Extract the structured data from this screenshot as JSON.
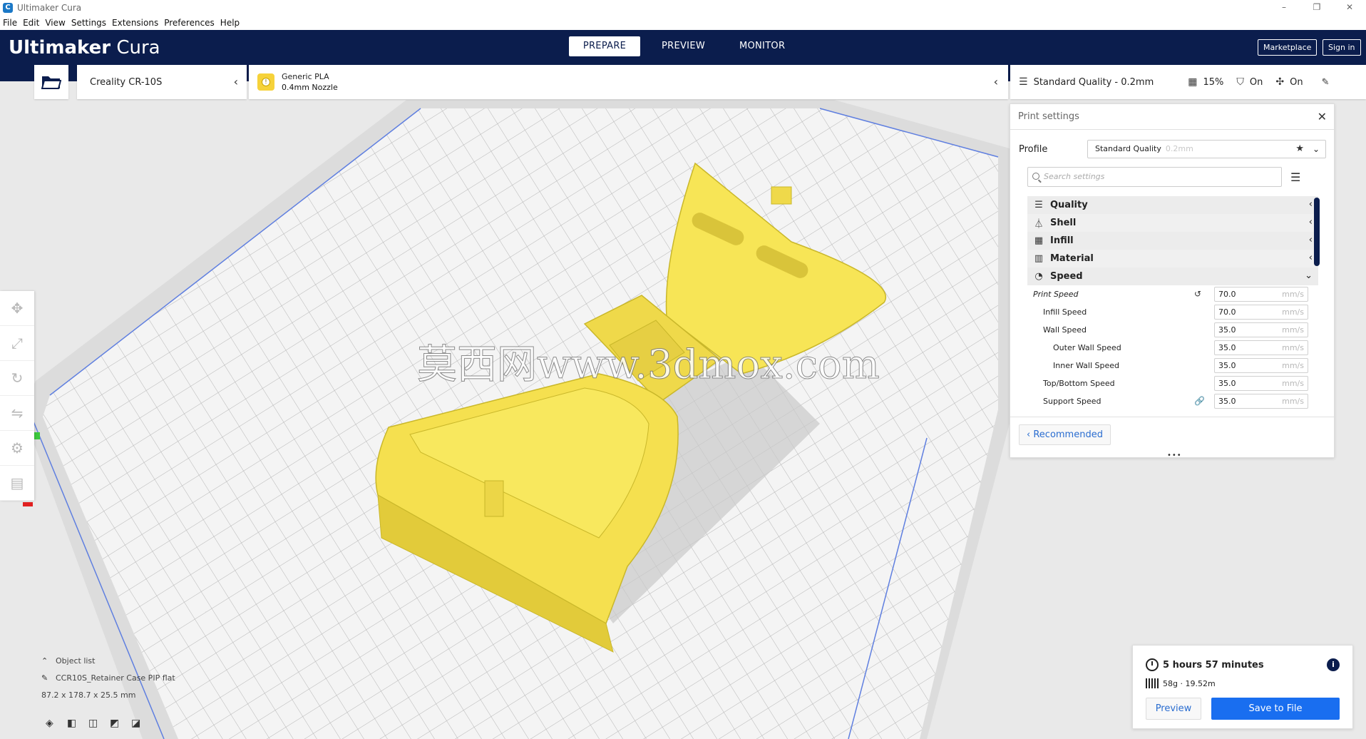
{
  "window": {
    "title": "Ultimaker Cura",
    "controls": [
      "–",
      "❐",
      "✕"
    ]
  },
  "menu": [
    "File",
    "Edit",
    "View",
    "Settings",
    "Extensions",
    "Preferences",
    "Help"
  ],
  "header": {
    "logo_bold": "Ultimaker",
    "logo_light": "Cura",
    "tabs": [
      "PREPARE",
      "PREVIEW",
      "MONITOR"
    ],
    "active_tab": "PREPARE",
    "marketplace": "Marketplace",
    "sign_in": "Sign in"
  },
  "stage": {
    "printer": "Creality CR-10S",
    "material": "Generic PLA",
    "nozzle": "0.4mm Nozzle",
    "quality": "Standard Quality - 0.2mm",
    "infill": "15%",
    "support": "On",
    "adhesion": "On"
  },
  "print_settings": {
    "title": "Print settings",
    "profile_label": "Profile",
    "profile_value": "Standard Quality",
    "profile_sub": "0.2mm",
    "search_placeholder": "Search settings",
    "categories": [
      {
        "label": "Quality",
        "icon": "quality-icon",
        "expanded": false
      },
      {
        "label": "Shell",
        "icon": "shell-icon",
        "expanded": false
      },
      {
        "label": "Infill",
        "icon": "infill-icon",
        "expanded": false
      },
      {
        "label": "Material",
        "icon": "material-icon",
        "expanded": false
      },
      {
        "label": "Speed",
        "icon": "speed-icon",
        "expanded": true
      }
    ],
    "speed_settings": [
      {
        "name": "Print Speed",
        "value": "70.0",
        "unit": "mm/s",
        "level": 0
      },
      {
        "name": "Infill Speed",
        "value": "70.0",
        "unit": "mm/s",
        "level": 1
      },
      {
        "name": "Wall Speed",
        "value": "35.0",
        "unit": "mm/s",
        "level": 1
      },
      {
        "name": "Outer Wall Speed",
        "value": "35.0",
        "unit": "mm/s",
        "level": 2
      },
      {
        "name": "Inner Wall Speed",
        "value": "35.0",
        "unit": "mm/s",
        "level": 2
      },
      {
        "name": "Top/Bottom Speed",
        "value": "35.0",
        "unit": "mm/s",
        "level": 1
      },
      {
        "name": "Support Speed",
        "value": "35.0",
        "unit": "mm/s",
        "level": 1
      }
    ],
    "recommended": "Recommended"
  },
  "viewport": {
    "watermark": "莫西网www.3dmox.com"
  },
  "object_list": {
    "header": "Object list",
    "name": "CCR10S_Retainer Case PIP flat",
    "dimensions": "87.2 x 178.7 x 25.5 mm"
  },
  "estimate": {
    "time": "5 hours 57 minutes",
    "material": "58g · 19.52m",
    "preview": "Preview",
    "save": "Save to File"
  },
  "colors": {
    "header_bg": "#0b1d4d",
    "model_yellow": "#f5e04f",
    "accent_blue": "#196ef0"
  }
}
